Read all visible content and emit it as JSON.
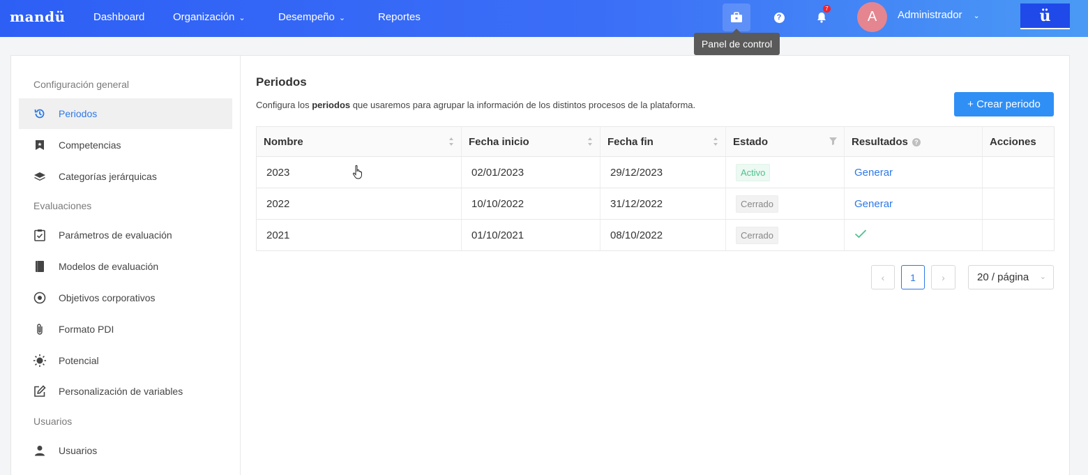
{
  "header": {
    "logo": "mandü",
    "nav": [
      {
        "label": "Dashboard"
      },
      {
        "label": "Organización"
      },
      {
        "label": "Desempeño"
      },
      {
        "label": "Reportes"
      }
    ],
    "notifications_count": "7",
    "avatar_letter": "A",
    "user_name": "Administrador",
    "brand_button": "ü",
    "tooltip": "Panel de control"
  },
  "sidebar": {
    "sections": [
      {
        "title": "Configuración general"
      },
      {
        "title": "Evaluaciones"
      },
      {
        "title": "Usuarios"
      }
    ],
    "items": [
      {
        "label": "Periodos",
        "icon": "history-icon",
        "active": true
      },
      {
        "label": "Competencias",
        "icon": "bookmark-icon"
      },
      {
        "label": "Categorías jerárquicas",
        "icon": "layers-icon"
      },
      {
        "label": "Parámetros de evaluación",
        "icon": "checklist-icon"
      },
      {
        "label": "Modelos de evaluación",
        "icon": "book-icon"
      },
      {
        "label": "Objetivos corporativos",
        "icon": "target-icon"
      },
      {
        "label": "Formato PDI",
        "icon": "paperclip-icon"
      },
      {
        "label": "Potencial",
        "icon": "sun-icon"
      },
      {
        "label": "Personalización de variables",
        "icon": "edit-icon"
      },
      {
        "label": "Usuarios",
        "icon": "user-icon"
      }
    ]
  },
  "main": {
    "title": "Periodos",
    "description_pre": "Configura los ",
    "description_bold": "periodos",
    "description_post": " que usaremos para agrupar la información de los distintos procesos de la plataforma.",
    "create_button": "+ Crear periodo",
    "table": {
      "columns": [
        "Nombre",
        "Fecha inicio",
        "Fecha fin",
        "Estado",
        "Resultados",
        "Acciones"
      ],
      "rows": [
        {
          "nombre": "2023",
          "inicio": "02/01/2023",
          "fin": "29/12/2023",
          "estado": "Activo",
          "resultados": "Generar"
        },
        {
          "nombre": "2022",
          "inicio": "10/10/2022",
          "fin": "31/12/2022",
          "estado": "Cerrado",
          "resultados": "Generar"
        },
        {
          "nombre": "2021",
          "inicio": "01/10/2021",
          "fin": "08/10/2022",
          "estado": "Cerrado",
          "resultados": ""
        }
      ]
    },
    "pagination": {
      "current_page": "1",
      "page_size": "20 / página"
    }
  },
  "colors": {
    "primary": "#2c78e8",
    "header_start": "#2d5ff5",
    "header_end": "#4a9af5",
    "active_tag": "#4cc28c"
  }
}
